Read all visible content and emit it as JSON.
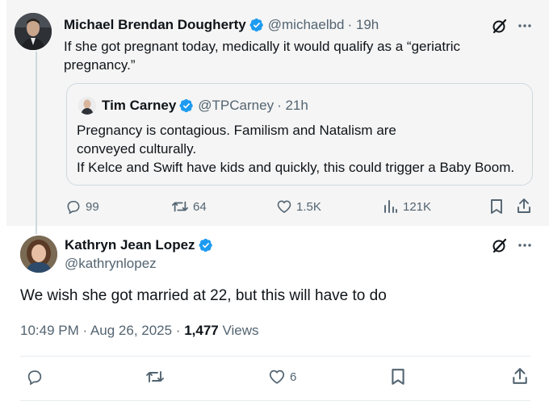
{
  "parent_tweet": {
    "author": "Michael Brendan Dougherty",
    "handle": "@michaelbd",
    "time": "· 19h",
    "text": "If she got pregnant today, medically it would qualify as a “geriatric pregnancy.”",
    "quote": {
      "author": "Tim Carney",
      "handle": "@TPCarney",
      "time": "· 21h",
      "line1": "Pregnancy is contagious. Familism and Natalism are conveyed culturally.",
      "line2": "If Kelce and Swift have kids and quickly, this could trigger a Baby Boom."
    },
    "replies": "99",
    "reposts": "64",
    "likes": "1.5K",
    "views": "121K"
  },
  "main_tweet": {
    "author": "Kathryn Jean Lopez",
    "handle": "@kathrynlopez",
    "text": "We wish she got married at 22, but this will have to do",
    "timestamp": "10:49 PM · Aug 26, 2025 ·",
    "views_count": "1,477",
    "views_label": "Views",
    "likes": "6"
  },
  "colors": {
    "verified": "#1d9bf0",
    "secondary_text": "#536471",
    "primary_text": "#0f1419",
    "parent_bg": "#f5f5f5"
  },
  "icons": [
    "grok-icon",
    "more-icon",
    "reply-icon",
    "repost-icon",
    "like-icon",
    "views-icon",
    "bookmark-icon",
    "share-icon",
    "verified-badge-icon"
  ]
}
